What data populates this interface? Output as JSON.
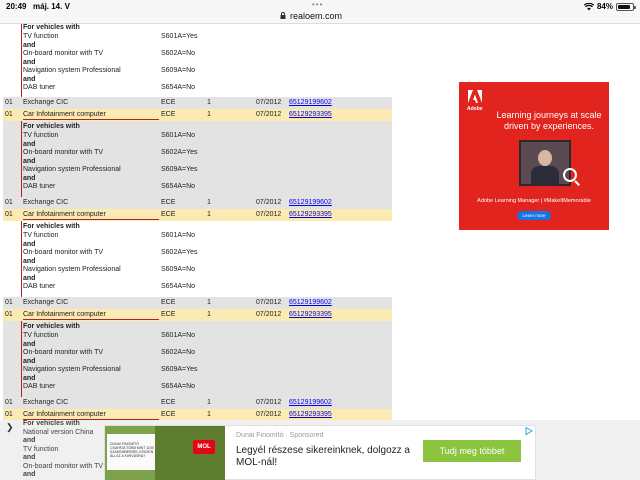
{
  "status_bar": {
    "time": "20:49",
    "date": "máj. 14. V",
    "url": "realoem.com",
    "battery": "84%",
    "battery_level": 0.84
  },
  "condition_values": {
    "header": "For vehicles with",
    "and": "and",
    "tv": "TV function",
    "monitor": "On-board monitor with TV",
    "nav": "Navigation system Professional",
    "dab": "DAB tuner"
  },
  "parts_table": {
    "blocks": [
      {
        "kind": "partial",
        "shade": "white",
        "lines": [
          {
            "text": "For vehicles with",
            "bold": true,
            "value": ""
          },
          {
            "text": "TV function",
            "bold": false,
            "value": "S601A=Yes"
          },
          {
            "text": "and",
            "bold": true,
            "value": ""
          },
          {
            "text": "On-board monitor with TV",
            "bold": false,
            "value": "S602A=No"
          },
          {
            "text": "and",
            "bold": true,
            "value": ""
          },
          {
            "text": "Navigation system Professional",
            "bold": false,
            "value": "S609A=No"
          },
          {
            "text": "and",
            "bold": true,
            "value": ""
          },
          {
            "text": "DAB tuner",
            "bold": false,
            "value": "S654A=No"
          }
        ]
      },
      {
        "kind": "rows",
        "rows": [
          {
            "no": "01",
            "desc": "Exchange CIC",
            "suppl": "ECE",
            "qty": "1",
            "date": "07/2012",
            "part": "65129199602",
            "style": "exchange"
          },
          {
            "no": "01",
            "desc": "Car Infotainment computer",
            "suppl": "ECE",
            "qty": "1",
            "date": "07/2012",
            "part": "65129293395",
            "style": "infot"
          }
        ]
      },
      {
        "kind": "cond",
        "shade": "grey",
        "lines": [
          {
            "text": "For vehicles with",
            "bold": true,
            "value": ""
          },
          {
            "text": "TV function",
            "bold": false,
            "value": "S601A=No"
          },
          {
            "text": "and",
            "bold": true,
            "value": ""
          },
          {
            "text": "On-board monitor with TV",
            "bold": false,
            "value": "S602A=Yes"
          },
          {
            "text": "and",
            "bold": true,
            "value": ""
          },
          {
            "text": "Navigation system Professional",
            "bold": false,
            "value": "S609A=Yes"
          },
          {
            "text": "and",
            "bold": true,
            "value": ""
          },
          {
            "text": "DAB tuner",
            "bold": false,
            "value": "S654A=No"
          }
        ]
      },
      {
        "kind": "rows",
        "rows": [
          {
            "no": "01",
            "desc": "Exchange CIC",
            "suppl": "ECE",
            "qty": "1",
            "date": "07/2012",
            "part": "65129199602",
            "style": "exchange"
          },
          {
            "no": "01",
            "desc": "Car Infotainment computer",
            "suppl": "ECE",
            "qty": "1",
            "date": "07/2012",
            "part": "65129293395",
            "style": "infot"
          }
        ]
      },
      {
        "kind": "cond",
        "shade": "white",
        "lines": [
          {
            "text": "For vehicles with",
            "bold": true,
            "value": ""
          },
          {
            "text": "TV function",
            "bold": false,
            "value": "S601A=No"
          },
          {
            "text": "and",
            "bold": true,
            "value": ""
          },
          {
            "text": "On-board monitor with TV",
            "bold": false,
            "value": "S602A=Yes"
          },
          {
            "text": "and",
            "bold": true,
            "value": ""
          },
          {
            "text": "Navigation system Professional",
            "bold": false,
            "value": "S609A=No"
          },
          {
            "text": "and",
            "bold": true,
            "value": ""
          },
          {
            "text": "DAB tuner",
            "bold": false,
            "value": "S654A=No"
          }
        ]
      },
      {
        "kind": "rows",
        "rows": [
          {
            "no": "01",
            "desc": "Exchange CIC",
            "suppl": "ECE",
            "qty": "1",
            "date": "07/2012",
            "part": "65129199602",
            "style": "exchange"
          },
          {
            "no": "01",
            "desc": "Car Infotainment computer",
            "suppl": "ECE",
            "qty": "1",
            "date": "07/2012",
            "part": "65129293395",
            "style": "infot"
          }
        ]
      },
      {
        "kind": "cond",
        "shade": "grey",
        "lines": [
          {
            "text": "For vehicles with",
            "bold": true,
            "value": ""
          },
          {
            "text": "TV function",
            "bold": false,
            "value": "S601A=No"
          },
          {
            "text": "and",
            "bold": true,
            "value": ""
          },
          {
            "text": "On-board monitor with TV",
            "bold": false,
            "value": "S602A=No"
          },
          {
            "text": "and",
            "bold": true,
            "value": ""
          },
          {
            "text": "Navigation system Professional",
            "bold": false,
            "value": "S609A=Yes"
          },
          {
            "text": "and",
            "bold": true,
            "value": ""
          },
          {
            "text": "DAB tuner",
            "bold": false,
            "value": "S654A=No"
          }
        ]
      },
      {
        "kind": "rows",
        "rows": [
          {
            "no": "01",
            "desc": "Exchange CIC",
            "suppl": "ECE",
            "qty": "1",
            "date": "07/2012",
            "part": "65129199602",
            "style": "exchange"
          },
          {
            "no": "01",
            "desc": "Car Infotainment computer",
            "suppl": "ECE",
            "qty": "1",
            "date": "07/2012",
            "part": "65129293395",
            "style": "infot"
          }
        ]
      }
    ],
    "tail_lines": [
      {
        "text": "For vehicles with",
        "bold": true
      },
      {
        "text": "National version China",
        "bold": false
      },
      {
        "text": "and",
        "bold": true
      },
      {
        "text": "TV function",
        "bold": false
      },
      {
        "text": "and",
        "bold": true
      },
      {
        "text": "On-board monitor with TV",
        "bold": false
      },
      {
        "text": "and",
        "bold": true
      }
    ]
  },
  "side_ad": {
    "brand": "Adobe",
    "headline": "Learning journeys at scale driven by experiences.",
    "subline": "Adobe Learning Manager | #MakeItMemorable",
    "button": "Learn more",
    "color": "#e1241d"
  },
  "bottom_banner": {
    "source": "Dunai Finomító · Sponsored",
    "text": "Legyél részese sikereinknek, dolgozz a MOL-nál!",
    "cta": "Tudj meg többet",
    "logo": "MOL",
    "image_caption": "DUNAI FINOMÍTÓ CSAPATA TÖBB MINT 1100 SZAKEMBERREL KÉSZEN ÁLLSZ A KIHÍVÁSRA?",
    "adchoices_icon": "adchoices-icon"
  }
}
